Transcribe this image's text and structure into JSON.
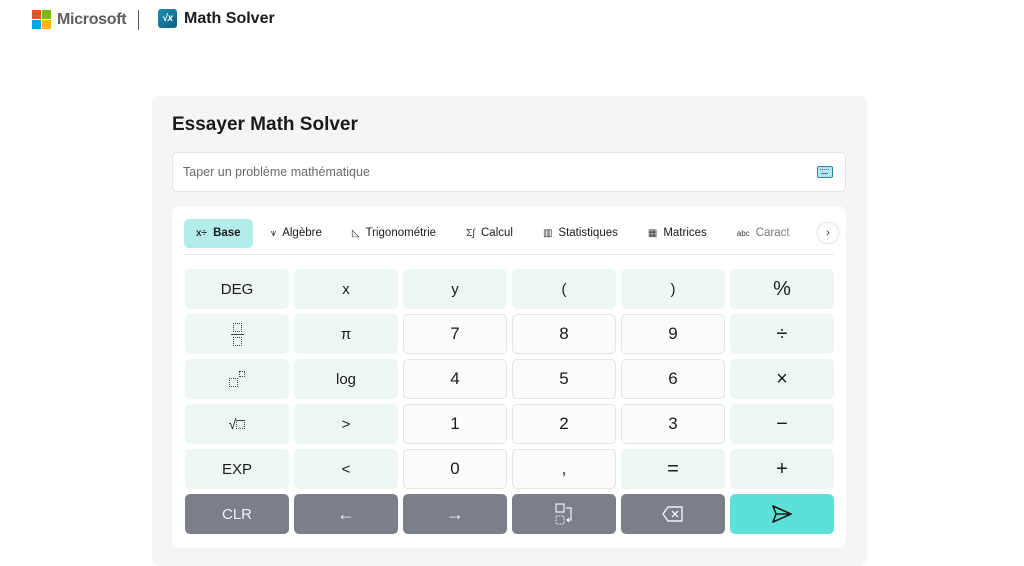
{
  "header": {
    "brand": "Microsoft",
    "app_icon_glyph": "√x",
    "app_name": "Math Solver",
    "brand_colors": [
      "#f25022",
      "#7fba00",
      "#00a4ef",
      "#ffb900"
    ]
  },
  "card": {
    "title": "Essayer Math Solver",
    "input": {
      "value": "",
      "placeholder": "Taper un problème mathématique",
      "icon": "keyboard-icon"
    }
  },
  "tabs": [
    {
      "label": "Base",
      "icon": "x÷",
      "active": true
    },
    {
      "label": "Algèbre",
      "icon": "⩛"
    },
    {
      "label": "Trigonométrie",
      "icon": "◺"
    },
    {
      "label": "Calcul",
      "icon": "Σ∫"
    },
    {
      "label": "Statistiques",
      "icon": "▥"
    },
    {
      "label": "Matrices",
      "icon": "▦"
    },
    {
      "label": "Caract",
      "icon": "abc"
    }
  ],
  "tabs_next_glyph": "›",
  "keys": {
    "r1": [
      "DEG",
      "x",
      "y",
      "(",
      ")",
      "%"
    ],
    "r2": [
      "fraction",
      "π",
      "7",
      "8",
      "9",
      "÷"
    ],
    "r3": [
      "exponent",
      "log",
      "4",
      "5",
      "6",
      "×"
    ],
    "r4": [
      "sqrt",
      ">",
      "1",
      "2",
      "3",
      "−"
    ],
    "r5": [
      "EXP",
      "<",
      "0",
      ",",
      "=",
      "+"
    ],
    "r6": [
      "CLR",
      "←",
      "→",
      "newline",
      "backspace",
      "submit"
    ]
  },
  "colors": {
    "accent": "#5de0d8",
    "active_tab": "#b3ede9",
    "control_key": "#7c7f88",
    "function_key": "#eef6f5"
  }
}
